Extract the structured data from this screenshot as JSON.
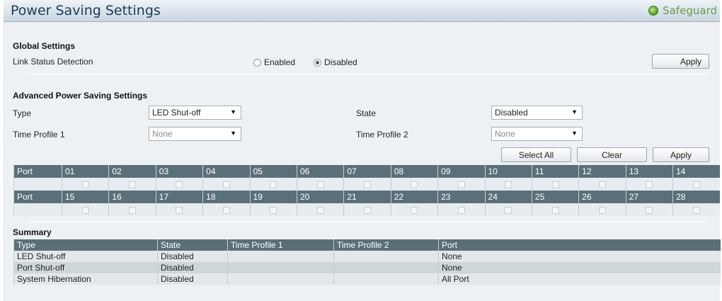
{
  "header": {
    "title": "Power Saving Settings",
    "safeguard_label": "Safeguard"
  },
  "global": {
    "heading": "Global Settings",
    "link_status_label": "Link Status Detection",
    "enabled_label": "Enabled",
    "disabled_label": "Disabled",
    "selected": "Disabled",
    "apply_label": "Apply"
  },
  "advanced": {
    "heading": "Advanced Power Saving Settings",
    "type_label": "Type",
    "type_value": "LED Shut-off",
    "state_label": "State",
    "state_value": "Disabled",
    "time_profile_1_label": "Time Profile 1",
    "time_profile_1_value": "None",
    "time_profile_2_label": "Time Profile 2",
    "time_profile_2_value": "None",
    "select_all_label": "Select All",
    "clear_label": "Clear",
    "apply_label": "Apply"
  },
  "ports": {
    "header_label": "Port",
    "row1": [
      "01",
      "02",
      "03",
      "04",
      "05",
      "06",
      "07",
      "08",
      "09",
      "10",
      "11",
      "12",
      "13",
      "14"
    ],
    "row2": [
      "15",
      "16",
      "17",
      "18",
      "19",
      "20",
      "21",
      "22",
      "23",
      "24",
      "25",
      "26",
      "27",
      "28"
    ]
  },
  "summary": {
    "heading": "Summary",
    "columns": [
      "Type",
      "State",
      "Time Profile 1",
      "Time Profile 2",
      "Port"
    ],
    "rows": [
      [
        "LED Shut-off",
        "Disabled",
        "",
        "",
        "None"
      ],
      [
        "Port Shut-off",
        "Disabled",
        "",
        "",
        "None"
      ],
      [
        "System Hibernation",
        "Disabled",
        "",
        "",
        "All Port"
      ]
    ]
  },
  "colors": {
    "table_header": "#5a7078",
    "panel_bg": "#eef1f4",
    "safeguard_green": "#6e9a4a"
  }
}
